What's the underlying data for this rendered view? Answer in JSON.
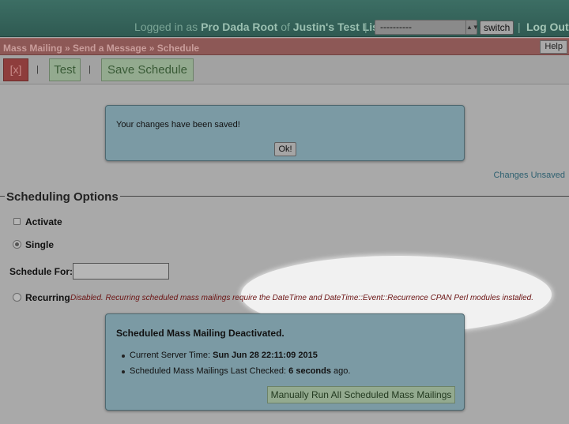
{
  "header": {
    "logged_in_prefix": "Logged in as ",
    "user": "Pro Dada Root",
    "of_text": " of ",
    "list_name": "Justin's Test List (j)",
    "sep": "|",
    "list_select_value": "----------",
    "switch_label": "switch",
    "logout_label": "Log Out"
  },
  "breadcrumb": {
    "text": "Mass Mailing » Send a Message » Schedule",
    "help_label": "Help"
  },
  "toolbar": {
    "close_label": "[x]",
    "pipe": "|",
    "test_label": "Test",
    "save_schedule_label": "Save Schedule"
  },
  "saved_dialog": {
    "message": "Your changes have been saved!",
    "ok_label": "Ok!"
  },
  "status": {
    "changes_unsaved": "Changes Unsaved"
  },
  "scheduling": {
    "legend": "Scheduling Options",
    "activate_label": "Activate",
    "single_label": "Single",
    "schedule_for_label": "Schedule For:",
    "schedule_for_value": "",
    "recurring_label": "Recurring",
    "recurring_note": "Disabled. Recurring scheduled mass mailings require the DateTime and DateTime::Event::Recurrence CPAN Perl modules installed."
  },
  "deactivated": {
    "title": "Scheduled Mass Mailing Deactivated.",
    "server_time_label": "Current Server Time: ",
    "server_time_value": "Sun Jun 28 22:11:09 2015",
    "last_checked_label": "Scheduled Mass Mailings Last Checked: ",
    "last_checked_value": "6 seconds",
    "last_checked_suffix": " ago.",
    "run_button_label": "Manually Run All Scheduled Mass Mailings"
  },
  "colors": {
    "header_bg": "#3c6e64",
    "breadcrumb_bg": "#8d5856",
    "panel_bg": "#7b9aa4",
    "button_green": "#93aa8f",
    "close_red": "#8e3d3c"
  }
}
